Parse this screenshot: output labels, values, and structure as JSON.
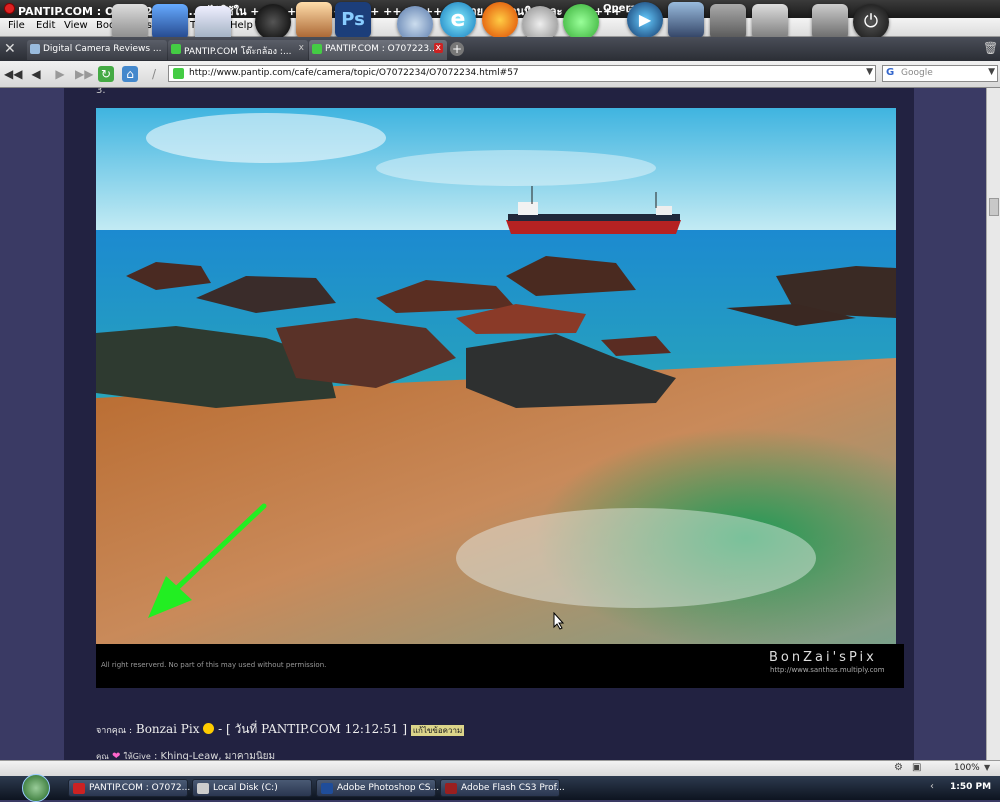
{
  "window": {
    "title": "PANTIP.COM : O7072234 ........ ไว้ใช้ใน ++++++++++++++ ++++ ++++ ราย ... ก้อนหิน และ ++++++ +++",
    "app_name": "Opera"
  },
  "menu": [
    "File",
    "Edit",
    "View",
    "Bookmarks",
    "Tools",
    "Help"
  ],
  "tabs": [
    {
      "label": "Digital Camera Reviews ...",
      "active": false
    },
    {
      "label": "PANTIP.COM โต๊ะกล้อง :...",
      "active": false
    },
    {
      "label": "PANTIP.COM : O707223...",
      "active": true
    }
  ],
  "address": {
    "url": "http://www.pantip.com/cafe/camera/topic/O7072234/O7072234.html#57",
    "search_placeholder": "Google"
  },
  "post": {
    "number": "3.",
    "copyright": "All right reserverd. No part of this may used without permission.",
    "watermark": "BonZai'sPix",
    "watermark_url": "http://www.santhas.multiply.com",
    "author_prefix": "จากคุณ :",
    "author": "Bonzai Pix",
    "date_prefix": "- [ วันที่",
    "date": "PANTIP.COM 12:12:51 ]",
    "edit_label": "แก้ไขข้อความ",
    "likes_prefix": "คุณ",
    "give_label": "ให้Give",
    "likes_users": ": Khing-Leaw, มาคามนิยม"
  },
  "status": {
    "zoom": "100%"
  },
  "taskbar": {
    "items": [
      {
        "label": "PANTIP.COM : O7072...",
        "color": "#cc2222"
      },
      {
        "label": "Local Disk (C:)",
        "color": "#c8c8c8"
      },
      {
        "label": "Adobe Photoshop CS...",
        "color": "#1f4d9a"
      },
      {
        "label": "Adobe Flash CS3 Prof...",
        "color": "#9a1f1f"
      }
    ],
    "clock": "1:50 PM"
  },
  "colors": {
    "accent_green": "#22ee22",
    "page_bg": "#3a3a64",
    "content_bg": "#222241"
  }
}
